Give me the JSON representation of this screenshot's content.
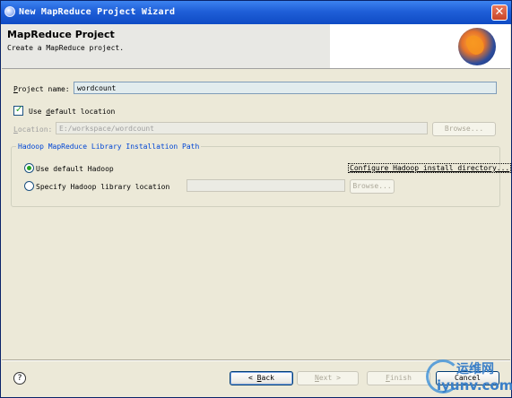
{
  "window": {
    "title": "New MapReduce Project Wizard",
    "close_glyph": "✕"
  },
  "banner": {
    "title": "MapReduce Project",
    "description": "Create a MapReduce project.",
    "logo_icon": "hadoop-elephant-logo-icon"
  },
  "form": {
    "project_name_label_mnemonic": "P",
    "project_name_label_rest": "roject name:",
    "project_name_value": "wordcount",
    "use_default_location_prefix": "Use ",
    "use_default_location_mnemonic": "d",
    "use_default_location_rest": "efault location",
    "use_default_location_checked": true,
    "location_label_mnemonic": "L",
    "location_label_rest": "ocation:",
    "location_value": "E:/workspace/wordcount",
    "browse_label": "Browse..."
  },
  "hadoop_group": {
    "title": "Hadoop MapReduce Library Installation Path",
    "use_default_hadoop": "Use default Hadoop",
    "use_default_hadoop_selected": true,
    "configure_link": "Configure Hadoop install directory...",
    "specify_location": "Specify Hadoop library location",
    "specify_location_value": "",
    "browse_label": "Browse..."
  },
  "footer": {
    "help_glyph": "?",
    "back_mnemonic": "B",
    "back_rest": "ack",
    "back_prefix": "< ",
    "next_mnemonic": "N",
    "next_rest": "ext >",
    "finish_mnemonic": "F",
    "finish_rest": "inish",
    "cancel_label": "Cancel"
  },
  "watermark": {
    "cn_text": "运维网",
    "en_text": "iyunv.com"
  },
  "colors": {
    "titlebar": "#1F5FD8",
    "dialog_bg": "#ECE9D8",
    "group_title": "#0046D5",
    "check_green": "#21A121"
  }
}
